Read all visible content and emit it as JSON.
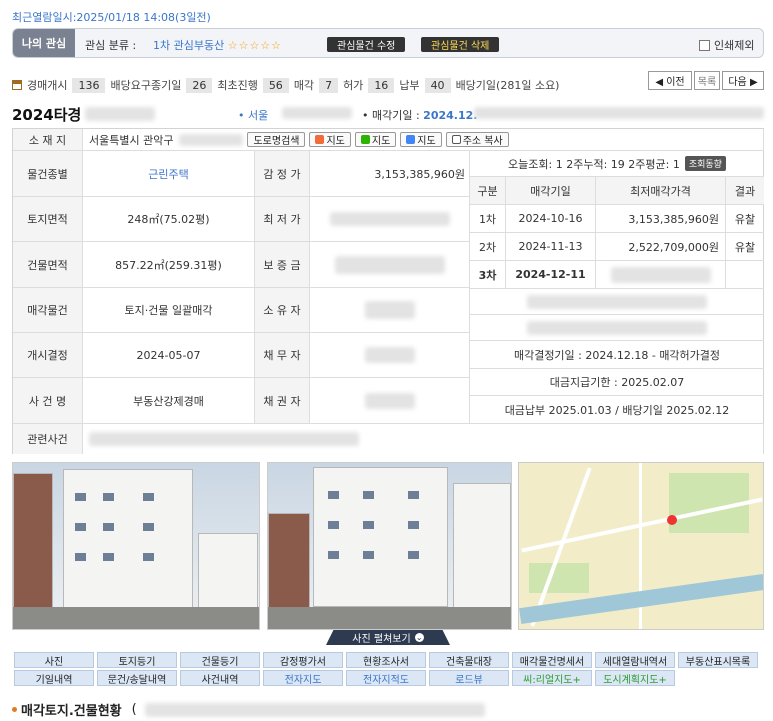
{
  "last_view": "최근열람일시:2025/01/18 14:08(3일전)",
  "interest": {
    "my_label": "나의 관심",
    "cls_label": "관심 분류 :",
    "cls_value": "1차 관심부동산",
    "stars": "☆☆☆☆☆",
    "edit_btn": "관심물건 수정",
    "delete_btn": "관심물건 삭제",
    "print_exclude": "인쇄제외"
  },
  "stats": {
    "items": [
      {
        "label": "경매개시",
        "value": "136"
      },
      {
        "label": "배당요구종기일",
        "value": "26"
      },
      {
        "label": "최초진행",
        "value": "56"
      },
      {
        "label": "매각",
        "value": "7"
      },
      {
        "label": "허가",
        "value": "16"
      },
      {
        "label": "납부",
        "value": "40"
      }
    ],
    "dividend": "배당기일(281일 소요)",
    "prev": "◀ 이전",
    "list": "목록",
    "next": "다음 ▶"
  },
  "case": {
    "year": "2024타경",
    "location": "• 서울",
    "sale_date_label": "• 매각기일 : ",
    "sale_date_value": "2024.12."
  },
  "details": {
    "address_label": "소 재 지",
    "address_value": "서울특별시 관악구",
    "road_btn": "도로명검색",
    "map1": "지도",
    "map2": "지도",
    "map3": "지도",
    "copy_btn": "주소 복사",
    "rows": [
      {
        "label": "물건종별",
        "value": "근린주택",
        "label2": "감 정 가",
        "value2": "3,153,385,960원"
      },
      {
        "label": "토지면적",
        "value": "248㎡(75.02평)",
        "label2": "최 저 가",
        "value2": ""
      },
      {
        "label": "건물면적",
        "value": "857.22㎡(259.31평)",
        "label2": "보 증 금",
        "value2": ""
      },
      {
        "label": "매각물건",
        "value": "토지·건물 일괄매각",
        "label2": "소 유 자",
        "value2": ""
      },
      {
        "label": "개시결정",
        "value": "2024-05-07",
        "label2": "채 무 자",
        "value2": ""
      },
      {
        "label": "사 건 명",
        "value": "부동산강제경매",
        "label2": "채 권 자",
        "value2": ""
      }
    ],
    "related_label": "관련사건"
  },
  "views": {
    "text": "오늘조회: 1  2주누적: 19  2주평균: 1",
    "btn": "조회동향"
  },
  "history": {
    "headers": [
      "구분",
      "매각기일",
      "최저매각가격",
      "결과"
    ],
    "rows": [
      {
        "no": "1차",
        "date": "2024-10-16",
        "price": "3,153,385,960원",
        "result": "유찰"
      },
      {
        "no": "2차",
        "date": "2024-11-13",
        "price": "2,522,709,000원",
        "result": "유찰"
      },
      {
        "no": "3차",
        "date": "2024-12-11",
        "price": "",
        "result": ""
      }
    ],
    "decision": "매각결정기일 : 2024.12.18 - 매각허가결정",
    "deadline": "대금지급기한 : 2025.02.07",
    "payment": "대금납부 2025.01.03 / 배당기일 2025.02.12"
  },
  "photo_toggle": "사진 펼쳐보기",
  "links": [
    [
      "사진",
      "토지등기",
      "건물등기",
      "감정평가서",
      "현황조사서",
      "건축물대장",
      "매각물건명세서",
      "세대열람내역서",
      "부동산표시목록"
    ],
    [
      "기일내역",
      "문건/송달내역",
      "사건내역",
      "전자지도",
      "전자지적도",
      "로드뷰",
      "씨:리얼지도+",
      "도시계획지도+"
    ]
  ],
  "section_title": "매각토지.건물현황",
  "section_paren": "("
}
